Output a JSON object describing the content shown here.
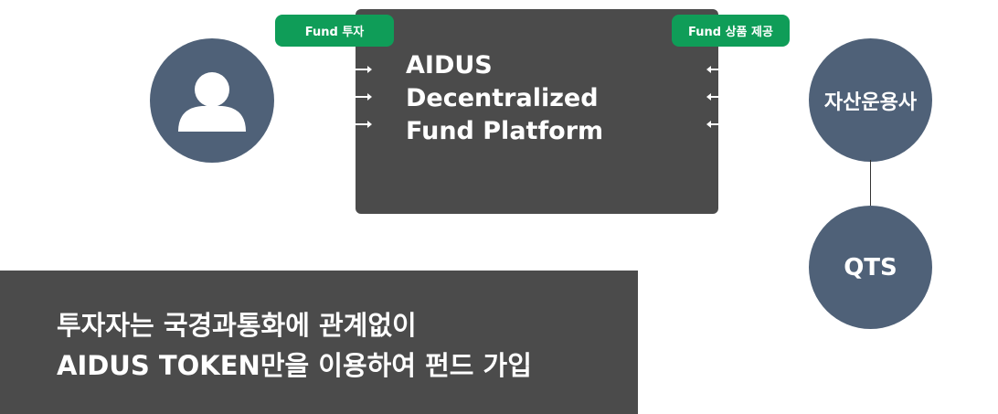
{
  "colors": {
    "node": "#4f6178",
    "platform": "#4b4b4b",
    "tag": "#0f9d58",
    "banner": "#4b4b4b"
  },
  "investor": {
    "icon": "user-icon"
  },
  "tags": {
    "invest": "Fund 투자",
    "provide": "Fund 상품 제공"
  },
  "platform": {
    "lines": [
      "AIDUS",
      "Decentralized",
      "Fund Platform"
    ]
  },
  "nodes": {
    "asset_manager": "자산운용사",
    "qts": "QTS"
  },
  "banner": {
    "lines": [
      "투자자는 국경과통화에 관계없이",
      "AIDUS TOKEN만을 이용하여 펀드 가입"
    ]
  }
}
